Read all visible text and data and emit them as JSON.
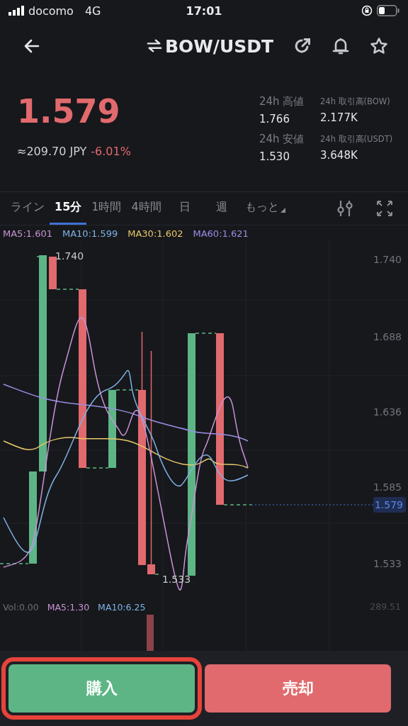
{
  "status_bar": {
    "carrier": "docomo",
    "network": "4G",
    "time": "17:01"
  },
  "header": {
    "pair": "BOW/USDT"
  },
  "price": {
    "last": "1.579",
    "fiat": "≈209.70 JPY",
    "change": "-6.01%"
  },
  "stats": [
    {
      "label": "24h 高値",
      "value": "1.766",
      "kind": "main"
    },
    {
      "label": "24h 取引高(BOW)",
      "value": "2.177K",
      "kind": "volume"
    },
    {
      "label": "24h 安値",
      "value": "1.530",
      "kind": "main"
    },
    {
      "label": "24h 取引高(USDT)",
      "value": "3.648K",
      "kind": "volume"
    }
  ],
  "intervals": [
    {
      "label": "ライン",
      "selected": false
    },
    {
      "label": "15分",
      "selected": true
    },
    {
      "label": "1時間",
      "selected": false
    },
    {
      "label": "4時間",
      "selected": false
    },
    {
      "label": "日",
      "selected": false
    },
    {
      "label": "週",
      "selected": false
    },
    {
      "label": "もっと",
      "selected": false
    }
  ],
  "ma_legend": [
    {
      "label": "MA5:1.601",
      "color": "#c993d6"
    },
    {
      "label": "MA10:1.599",
      "color": "#7fb3e6"
    },
    {
      "label": "MA30:1.602",
      "color": "#e8c86a"
    },
    {
      "label": "MA60:1.621",
      "color": "#9b8ee6"
    }
  ],
  "chart": {
    "y_axis": [
      "1.740",
      "1.688",
      "1.636",
      "1.585",
      "1.533"
    ],
    "high_label": "1.740",
    "low_label": "1.533",
    "last_price": "1.579"
  },
  "volume": {
    "legend": [
      {
        "label": "Vol:0.00",
        "color": "#6b6e75"
      },
      {
        "label": "MA5:1.30",
        "color": "#c993d6"
      },
      {
        "label": "MA10:6.25",
        "color": "#7fb3e6"
      }
    ],
    "max": "289.51"
  },
  "actions": [
    {
      "label": "購入",
      "kind": "buy",
      "highlighted": true
    },
    {
      "label": "売却",
      "kind": "sell",
      "highlighted": false
    }
  ]
}
